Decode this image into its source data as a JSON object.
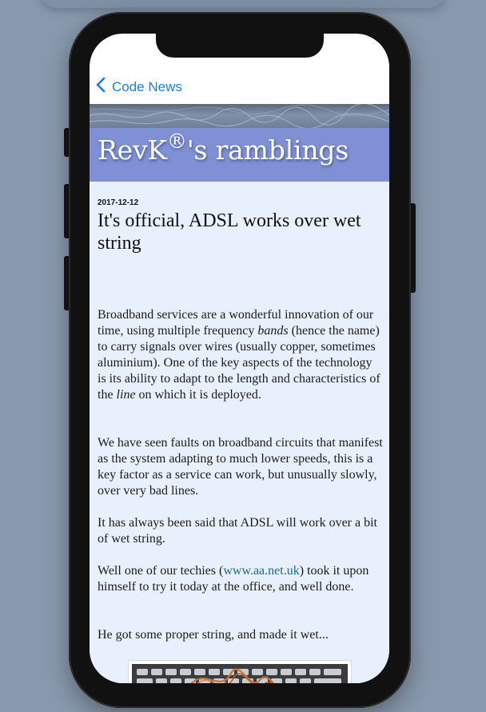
{
  "nav": {
    "back_label": "Code News"
  },
  "site": {
    "title_main": "RevK",
    "title_mark": "®",
    "title_suffix": "'s ramblings"
  },
  "post": {
    "date": "2017-12-12",
    "title": "It's official, ADSL works over wet string",
    "p1": {
      "a": "Broadband services are a wonderful innovation of our time, using multiple frequency ",
      "b": "bands",
      "c": " (hence the name) to carry signals over wires (usually copper, sometimes aluminium). One of the key aspects of the technology is its ability to adapt to the length and characteristics of the ",
      "d": "line",
      "e": " on which it is deployed."
    },
    "p2": "We have seen faults on broadband circuits that manifest as the system adapting to much lower speeds, this is a key factor as a service can work, but unusually slowly, over very bad lines.",
    "p3": "It has always been said that ADSL will work over a bit of wet string.",
    "p4": {
      "a": "Well one of our techies (",
      "link": "www.aa.net.uk",
      "b": ") took it upon himself to try it today at the office, and well done."
    },
    "p5": "He got some proper string, and made it wet..."
  },
  "colors": {
    "accent": "#1a7fe5",
    "banner": "#7f90d4",
    "page_background": "#e9f0fd",
    "link": "#1a6a8e",
    "backdrop": "#8899ad"
  },
  "icons": {
    "back": "chevron-left-icon",
    "figure": "keyboard-string-photo"
  }
}
